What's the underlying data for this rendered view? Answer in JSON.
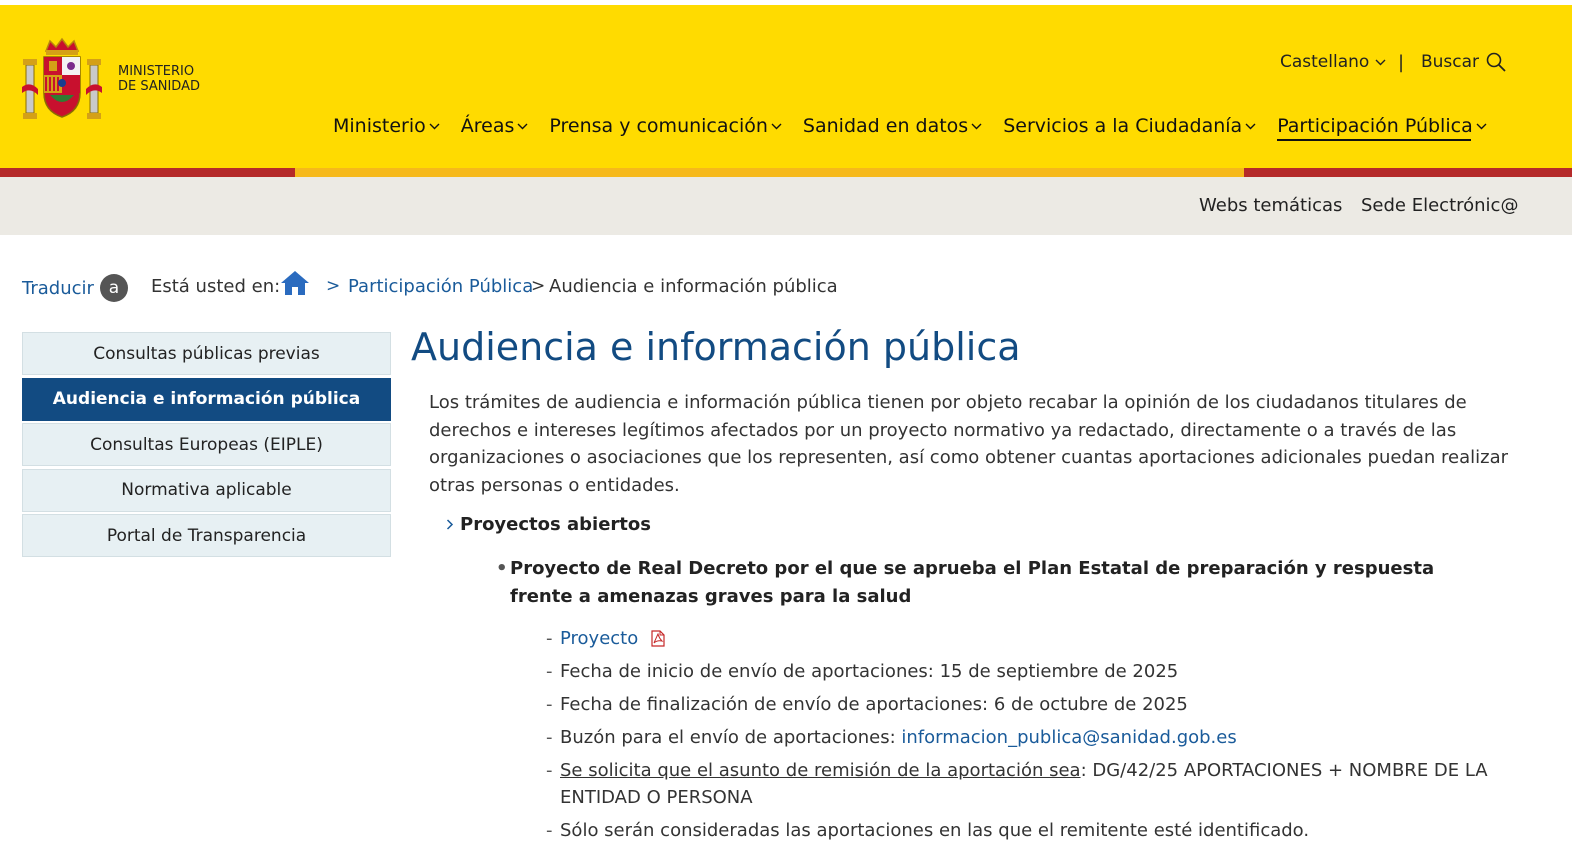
{
  "header": {
    "logo_text_line1": "MINISTERIO",
    "logo_text_line2": "DE SANIDAD",
    "language": "Castellano",
    "separator": "|",
    "search_label": "Buscar",
    "nav": [
      {
        "label": "Ministerio"
      },
      {
        "label": "Áreas"
      },
      {
        "label": "Prensa y comunicación"
      },
      {
        "label": "Sanidad en datos"
      },
      {
        "label": "Servicios a la Ciudadanía"
      },
      {
        "label": "Participación Pública"
      }
    ],
    "colors": {
      "yellow": "#ffdb00",
      "red": "#b52a2a",
      "orange": "#f6b91b"
    }
  },
  "subbar": {
    "links": [
      {
        "label": "Webs temáticas"
      },
      {
        "label": "Sede Electrónic@"
      }
    ]
  },
  "breadcrumb": {
    "translate_label": "Traducir",
    "translate_badge": "a",
    "prefix": "Está usted en:",
    "sep1": ">",
    "item1": "Participación Pública",
    "sep2": ">",
    "item2": "Audiencia e información pública"
  },
  "sidebar": {
    "items": [
      {
        "label": "Consultas públicas previas"
      },
      {
        "label": "Audiencia e información pública"
      },
      {
        "label": "Consultas Europeas (EIPLE)"
      },
      {
        "label": "Normativa aplicable"
      },
      {
        "label": "Portal de Transparencia"
      }
    ]
  },
  "main": {
    "title": "Audiencia e información pública",
    "intro": "Los trámites de audiencia e información pública tienen por objeto recabar la opinión de los ciudadanos titulares de derechos e intereses legítimos afectados por un proyecto normativo ya redactado, directamente o a través de las organizaciones o asociaciones que los representen, así como obtener cuantas aportaciones adicionales puedan realizar otras personas o entidades.",
    "section_title": "Proyectos abiertos",
    "bullet": "•",
    "dash": "-",
    "project_title": "Proyecto de Real Decreto por el que se aprueba el Plan Estatal de preparación y respuesta frente a amenazas graves para la salud",
    "details": {
      "project_link": "Proyecto",
      "start_date": "Fecha de inicio de envío de aportaciones: 15 de septiembre de 2025",
      "end_date": "Fecha de finalización de envío de aportaciones: 6 de octubre de 2025",
      "mailbox_prefix": "Buzón para el envío de aportaciones: ",
      "mailbox_email": "informacion_publica@sanidad.gob.es",
      "subject_underlined": "Se solicita que el asunto de remisión de la aportación sea",
      "subject_rest": ": DG/42/25 APORTACIONES + NOMBRE DE LA ENTIDAD O PERSONA",
      "identified": "Sólo serán consideradas las aportaciones en las que el remitente esté identificado."
    }
  }
}
